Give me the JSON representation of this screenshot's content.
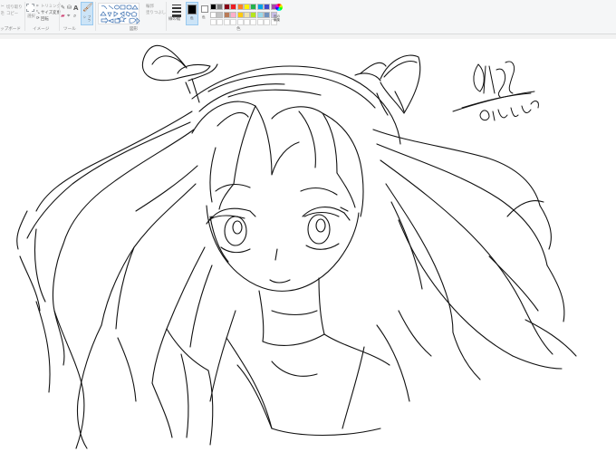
{
  "clipboard": {
    "cut_label": "切り取り",
    "copy_label": "コピー",
    "group_label": "ップボード"
  },
  "image": {
    "trim_label": "トリミング",
    "resize_label": "サイズ変更",
    "rotate_label": "回転",
    "group_label": "イメージ"
  },
  "tools": {
    "text_label": "A",
    "group_label": "ツール"
  },
  "brushes": {
    "label": "ブラシ"
  },
  "shapes": {
    "outline_label": "輪郭",
    "fill_label": "塗りつぶし",
    "group_label": "図形"
  },
  "size": {
    "label": "線の幅"
  },
  "colors": {
    "color1_label": "色\n1",
    "color2_label": "色\n2",
    "edit_label": "色の\n編集",
    "group_label": "色",
    "palette": [
      "#000000",
      "#7f7f7f",
      "#880015",
      "#ed1c24",
      "#ff7f27",
      "#fff200",
      "#22b14c",
      "#00a2e8",
      "#3f48cc",
      "#a349a4",
      "#ffffff",
      "#c3c3c3",
      "#b97a57",
      "#ffaec9",
      "#ffc90e",
      "#efe4b0",
      "#b5e61d",
      "#99d9ea",
      "#7092be",
      "#c8bfe7"
    ],
    "color1": "#000000",
    "color2": "#ffffff"
  },
  "canvas": {
    "stroke_color": "#111111"
  }
}
